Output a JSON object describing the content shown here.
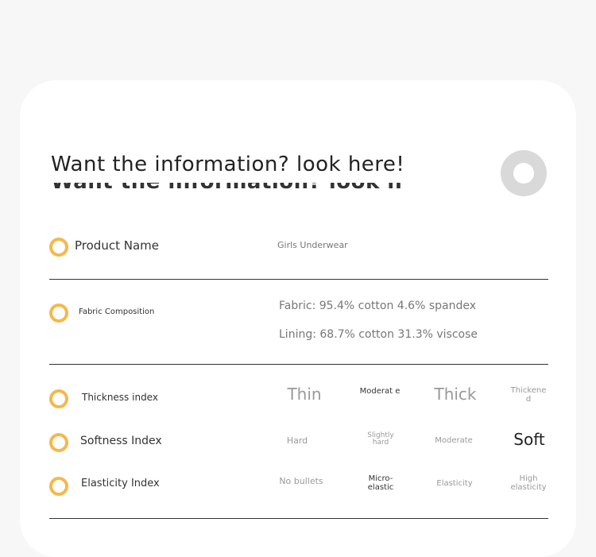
{
  "headline": "Want the information? look here!",
  "colors": {
    "accent": "#f5b94a",
    "text": "#333333",
    "muted": "#888888",
    "ring": "#d9d9d9"
  },
  "product": {
    "label": "Product Name",
    "value": "Girls Underwear"
  },
  "fabric": {
    "label": "Fabric Composition",
    "lines": [
      "Fabric: 95.4% cotton 4.6% spandex",
      "Lining: 68.7% cotton 31.3% viscose"
    ]
  },
  "thickness": {
    "label": "Thickness index",
    "options": [
      "Thin",
      "Moderat e",
      "Thick",
      "Thickene d"
    ]
  },
  "softness": {
    "label": "Softness Index",
    "options": [
      "Hard",
      "Slightly hard",
      "Moderate",
      "Soft"
    ]
  },
  "elasticity": {
    "label": "Elasticity Index",
    "options": [
      "No bullets",
      "Micro-elastic",
      "Elasticity",
      "High elasticity"
    ]
  }
}
